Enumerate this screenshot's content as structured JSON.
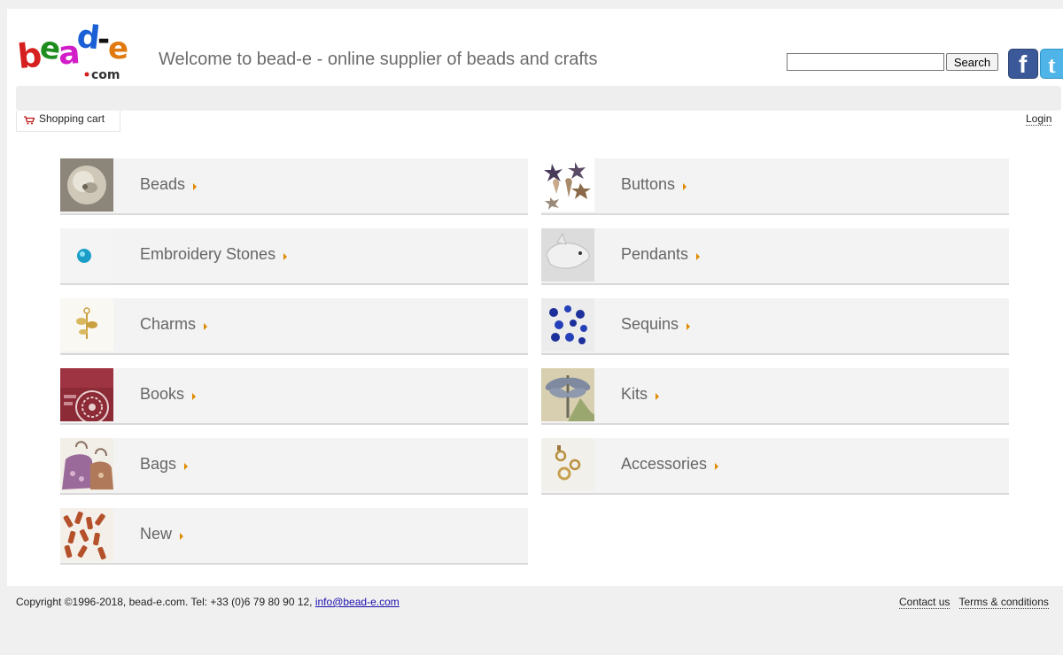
{
  "header": {
    "logo_text": "bead-e",
    "logo_suffix": "com",
    "welcome": "Welcome to bead-e - online supplier of beads and crafts",
    "search": {
      "value": "",
      "placeholder": "",
      "button_label": "Search"
    },
    "social": [
      {
        "name": "facebook-icon",
        "glyph": "f",
        "color": "#3b5998"
      },
      {
        "name": "twitter-icon",
        "glyph": "t",
        "color": "#4fb5e8"
      }
    ]
  },
  "nav": {
    "cart_label": "Shopping cart",
    "login_label": "Login"
  },
  "categories": [
    {
      "label": "Beads"
    },
    {
      "label": "Buttons"
    },
    {
      "label": "Embroidery Stones"
    },
    {
      "label": "Pendants"
    },
    {
      "label": "Charms"
    },
    {
      "label": "Sequins"
    },
    {
      "label": "Books"
    },
    {
      "label": "Kits"
    },
    {
      "label": "Bags"
    },
    {
      "label": "Accessories"
    },
    {
      "label": "New"
    }
  ],
  "footer": {
    "copyright": "Copyright ©1996-2018, bead-e.com. Tel: +33 (0)6 79 80 90 12, ",
    "email": "info@bead-e.com",
    "contact_label": "Contact us",
    "terms_label": "Terms & conditions"
  },
  "colors": {
    "accent_arrow": "#e08a00",
    "tile_bg": "#f3f3f3",
    "page_bg": "#f0f0f0"
  }
}
